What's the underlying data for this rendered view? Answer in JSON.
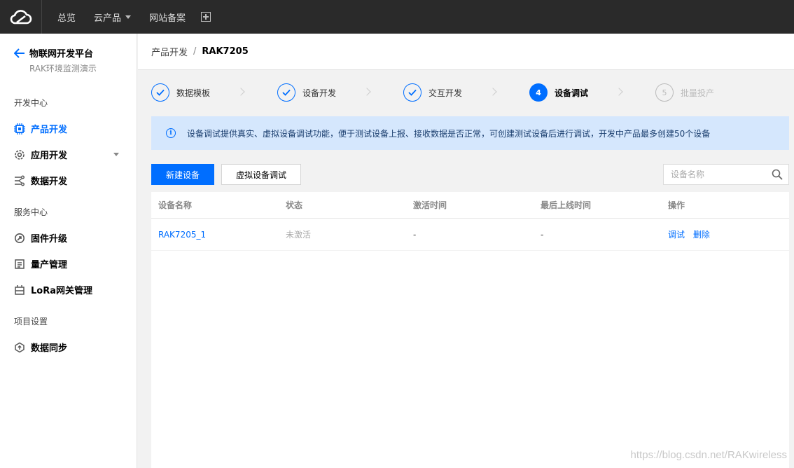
{
  "topbar": {
    "nav": [
      {
        "label": "总览"
      },
      {
        "label": "云产品"
      },
      {
        "label": "网站备案"
      }
    ]
  },
  "sidebar": {
    "platform_title": "物联网开发平台",
    "platform_subtitle": "RAK环境监测演示",
    "sections": [
      {
        "title": "开发中心",
        "items": [
          {
            "label": "产品开发",
            "icon": "chip-icon",
            "active": true
          },
          {
            "label": "应用开发",
            "icon": "gear-icon",
            "expandable": true
          },
          {
            "label": "数据开发",
            "icon": "flow-icon"
          }
        ]
      },
      {
        "title": "服务中心",
        "items": [
          {
            "label": "固件升级",
            "icon": "firmware-icon"
          },
          {
            "label": "量产管理",
            "icon": "list-icon"
          },
          {
            "label": "LoRa网关管理",
            "icon": "gateway-icon"
          }
        ]
      },
      {
        "title": "项目设置",
        "items": [
          {
            "label": "数据同步",
            "icon": "sync-icon"
          }
        ]
      }
    ]
  },
  "breadcrumb": {
    "parent": "产品开发",
    "separator": "/",
    "current": "RAK7205"
  },
  "steps": [
    {
      "label": "数据模板",
      "state": "done"
    },
    {
      "label": "设备开发",
      "state": "done"
    },
    {
      "label": "交互开发",
      "state": "done"
    },
    {
      "label": "设备调试",
      "state": "current",
      "number": "4"
    },
    {
      "label": "批量投产",
      "state": "todo",
      "number": "5"
    }
  ],
  "banner": {
    "text": "设备调试提供真实、虚拟设备调试功能，便于测试设备上报、接收数据是否正常，可创建测试设备后进行调试，开发中产品最多创建50个设备"
  },
  "toolbar": {
    "new_device_label": "新建设备",
    "virtual_debug_label": "虚拟设备调试",
    "search_placeholder": "设备名称"
  },
  "table": {
    "columns": [
      "设备名称",
      "状态",
      "激活时间",
      "最后上线时间",
      "操作"
    ],
    "rows": [
      {
        "name": "RAK7205_1",
        "status": "未激活",
        "activated": "-",
        "last_online": "-",
        "ops": [
          "调试",
          "删除"
        ]
      }
    ]
  },
  "watermark": "https://blog.csdn.net/RAKwireless",
  "colors": {
    "accent": "#006eff",
    "topbar": "#2a2a2a",
    "banner": "#d5e7fd"
  }
}
